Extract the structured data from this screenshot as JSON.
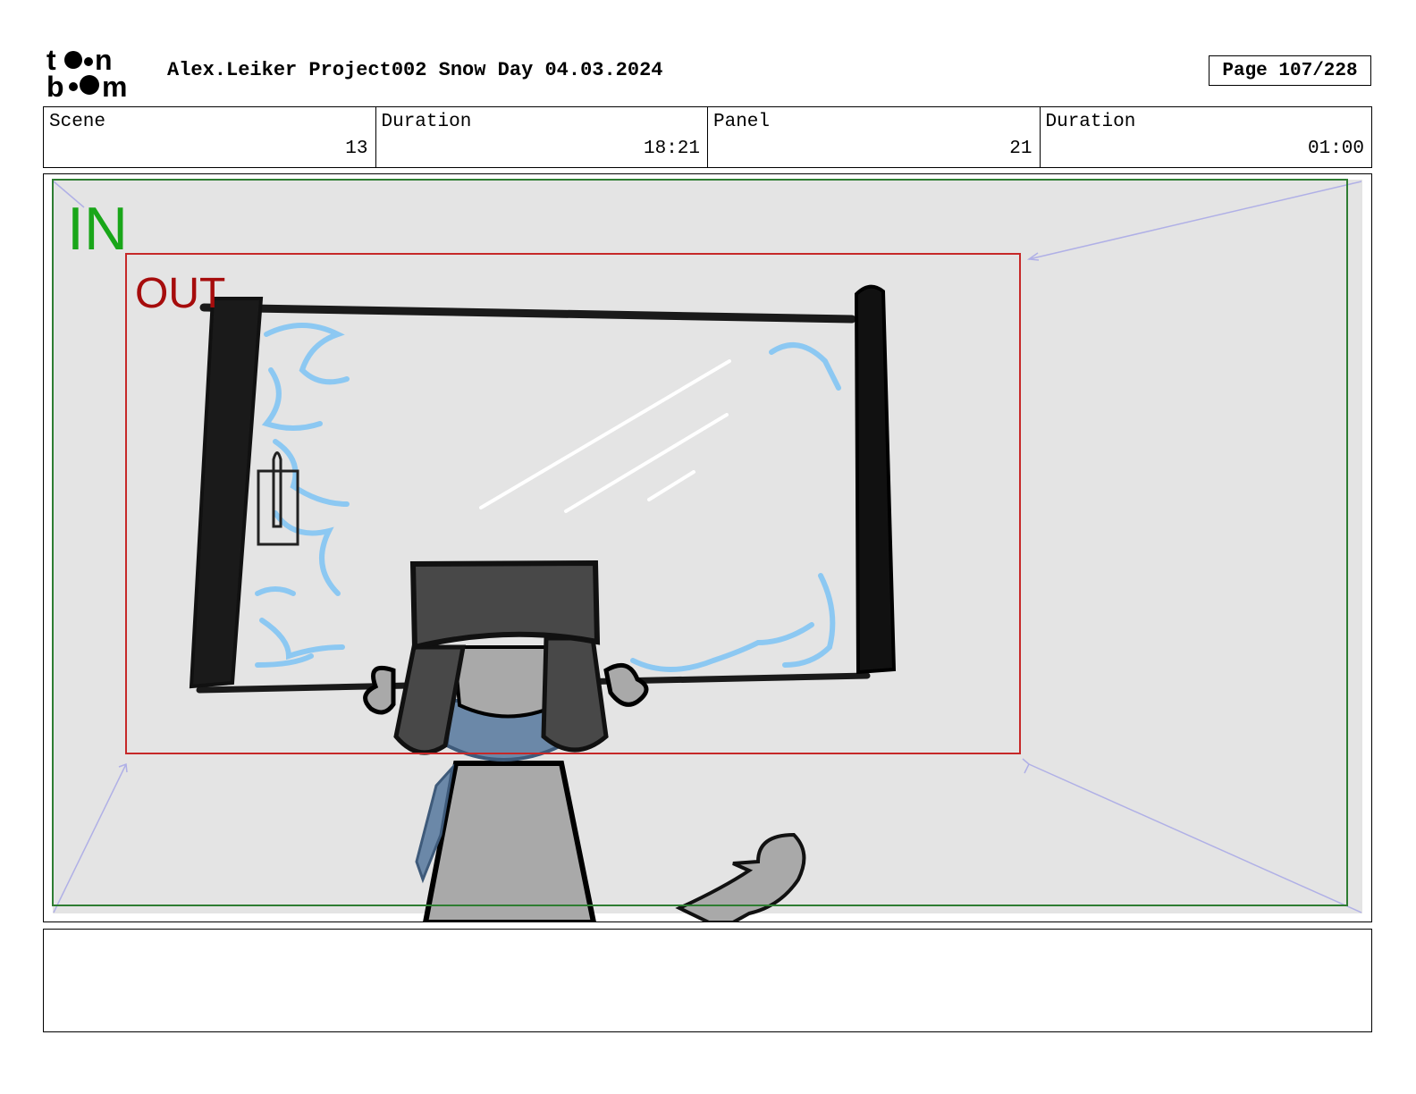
{
  "header": {
    "title": "Alex.Leiker Project002 Snow Day 04.03.2024",
    "page": "Page 107/228"
  },
  "info": {
    "scene_label": "Scene",
    "scene_value": "13",
    "scene_duration_label": "Duration",
    "scene_duration_value": "18:21",
    "panel_label": "Panel",
    "panel_value": "21",
    "panel_duration_label": "Duration",
    "panel_duration_value": "01:00"
  },
  "frame_labels": {
    "in": "IN",
    "out": "OUT"
  },
  "colors": {
    "in_frame": "#2e7d32",
    "out_frame": "#c62828",
    "camera_arrow": "#b0b0e6",
    "panel_bg": "#e4e4e4",
    "frost": "#8cc8f2"
  },
  "notes": ""
}
